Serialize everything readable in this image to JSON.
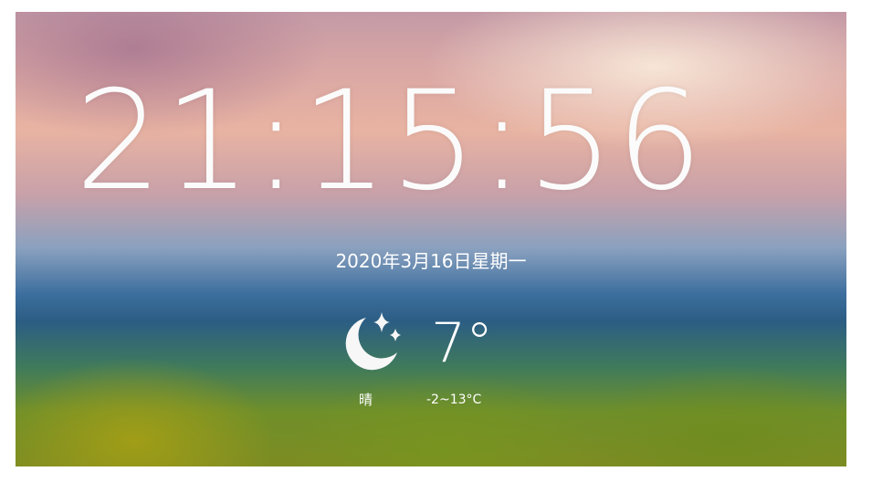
{
  "clock": {
    "time": "21:15:56",
    "date": "2020年3月16日星期一"
  },
  "weather": {
    "icon": "moon-stars-icon",
    "temperature": "7°",
    "condition": "晴",
    "range": "-2~13°C"
  },
  "colors": {
    "text": "#ffffff",
    "sky_top": "#e8b3a2",
    "water": "#2b5d84",
    "ground": "#7d8c22"
  }
}
